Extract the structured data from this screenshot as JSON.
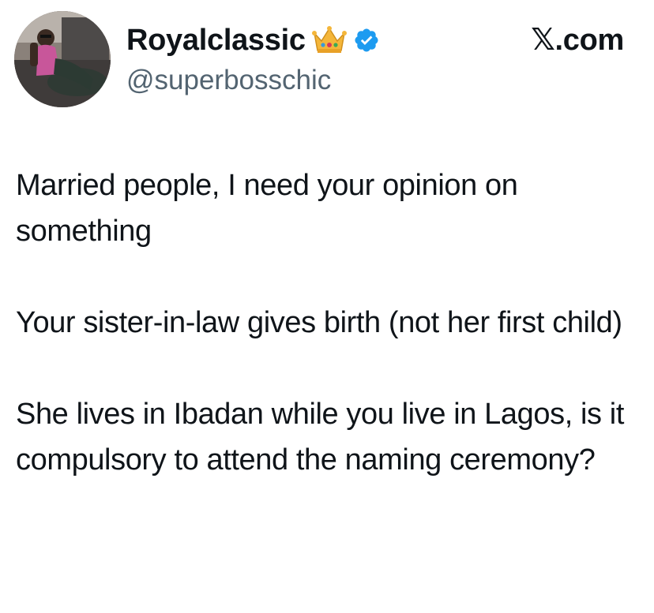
{
  "author": {
    "display_name": "Royalclassic",
    "handle": "@superbosschic",
    "badges": [
      "crown-emoji-icon",
      "verified-badge-icon"
    ],
    "verified_color": "#1d9bf0"
  },
  "brand": {
    "label": "𝕏.com"
  },
  "tweet": {
    "paragraphs": [
      "Married people, I need your opinion on something",
      "Your sister-in-law gives birth (not her first child)",
      "She lives in Ibadan while you live in Lagos, is it compulsory to attend the naming ceremony?"
    ]
  }
}
